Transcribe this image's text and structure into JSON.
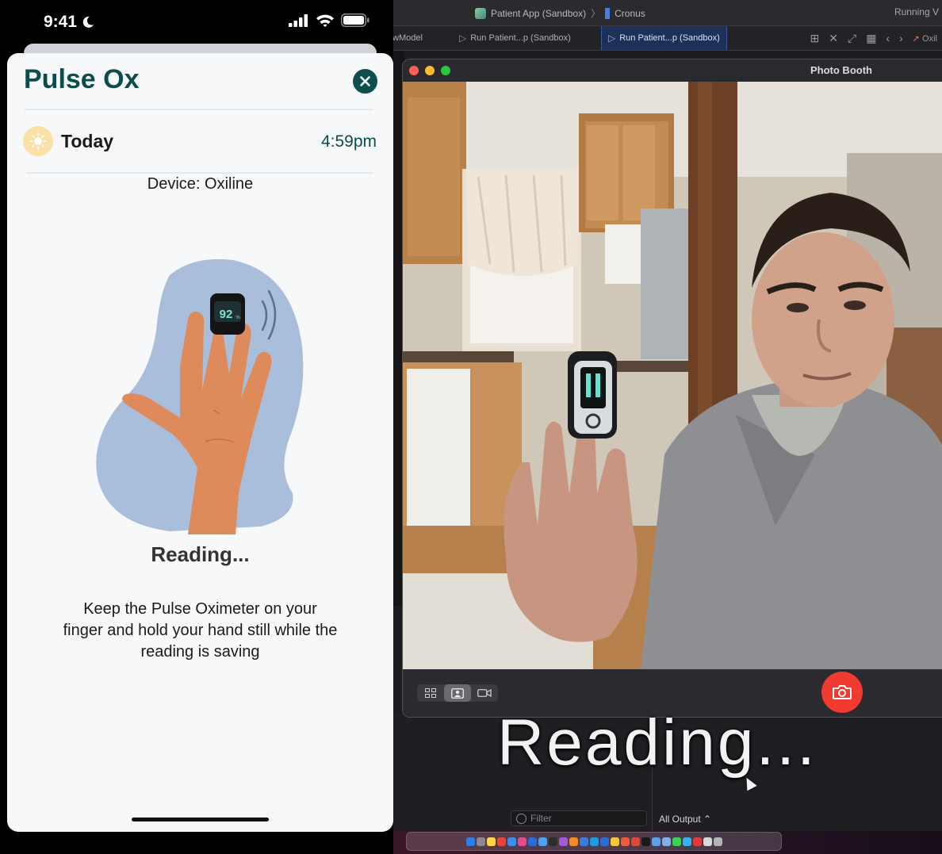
{
  "xcode": {
    "project": "Patient App (Sandbox)",
    "separator": "〉",
    "device": "Cronus",
    "running_status": "Running V",
    "tabs": [
      {
        "label": "wModel"
      },
      {
        "label": "Run Patient...p (Sandbox)"
      },
      {
        "label": "Run Patient...p (Sandbox)"
      },
      {
        "label": "Oxil"
      }
    ],
    "filter_placeholder": "Filter",
    "all_output": "All Output ⌃"
  },
  "overlay": {
    "caption": "Reading..."
  },
  "photo_booth": {
    "title": "Photo Booth",
    "view_modes": [
      "grid-icon",
      "portrait-icon",
      "video-icon"
    ],
    "selected_mode": "portrait-icon"
  },
  "phone": {
    "status": {
      "time": "9:41"
    },
    "sheet": {
      "title": "Pulse Ox",
      "day": "Today",
      "time": "4:59pm",
      "device": "Device: Oxiline",
      "oximeter_reading": "92",
      "oximeter_unit": "%",
      "status": "Reading...",
      "instructions": "Keep the Pulse Oximeter on your finger and hold your hand still while the reading is saving"
    }
  },
  "colors": {
    "brand_teal": "#0c4c4c",
    "shutter_red": "#f23b30",
    "sun_yellow": "#fbe0a7",
    "blob_blue": "#a9bedb",
    "hand": "#df8a5a"
  }
}
